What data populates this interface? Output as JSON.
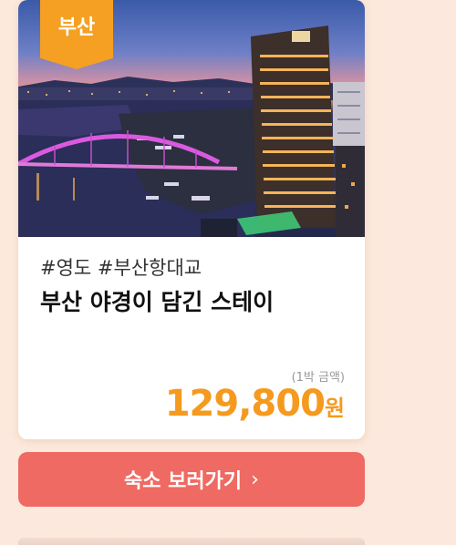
{
  "card": {
    "region_badge": "부산",
    "tags": "#영도 #부산항대교",
    "title": "부산 야경이 담긴 스테이",
    "price_note": "(1박 금액)",
    "price_amount": "129,800",
    "price_unit": "원"
  },
  "cta": {
    "label": "숙소 보러가기",
    "chevron": "›"
  },
  "colors": {
    "background": "#fce8dc",
    "badge": "#f5a022",
    "price": "#f59a1e",
    "button": "#ee6a62"
  }
}
